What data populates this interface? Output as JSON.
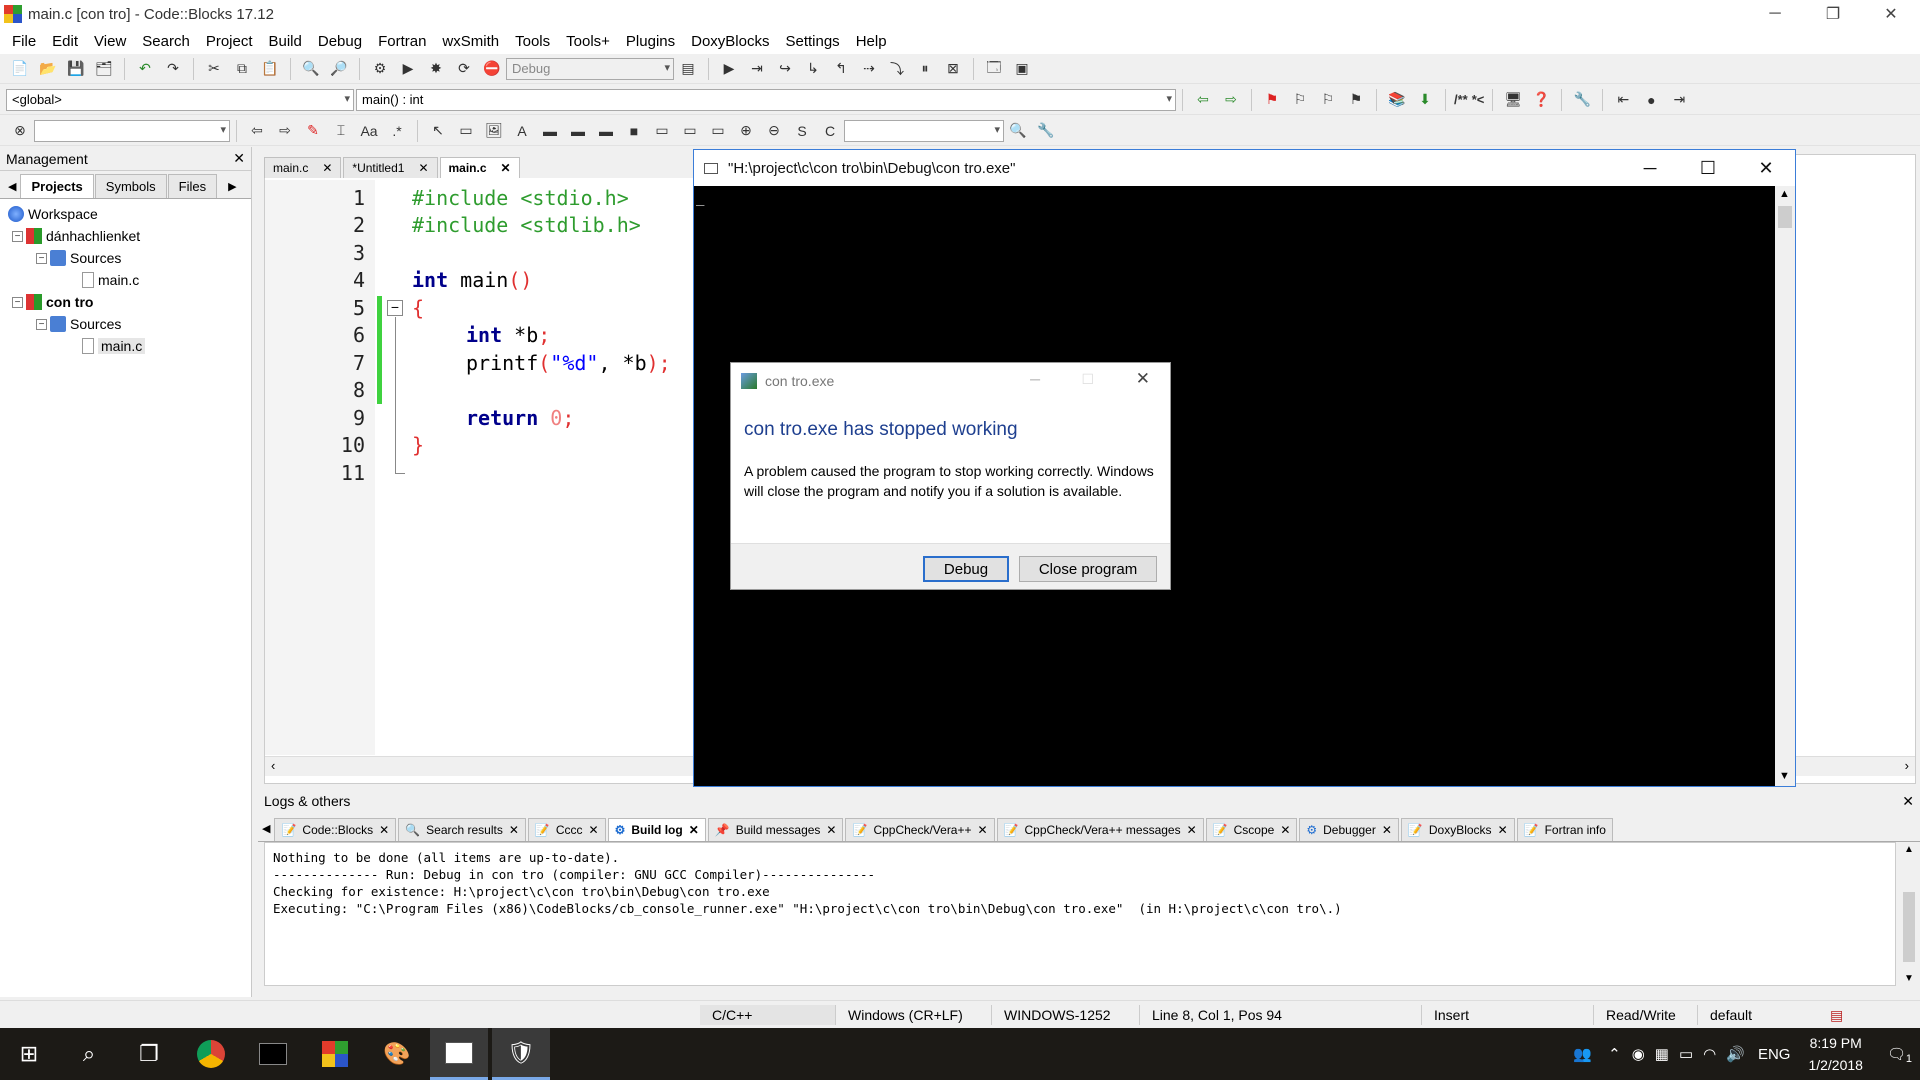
{
  "window": {
    "title": "main.c [con tro] - Code::Blocks 17.12",
    "min": "─",
    "max": "❐",
    "close": "✕"
  },
  "menu": [
    "File",
    "Edit",
    "View",
    "Search",
    "Project",
    "Build",
    "Debug",
    "Fortran",
    "wxSmith",
    "Tools",
    "Tools+",
    "Plugins",
    "DoxyBlocks",
    "Settings",
    "Help"
  ],
  "toolbar": {
    "build_target": "Debug",
    "scope": "<global>",
    "function": "main() : int",
    "doc_comment": "/**",
    "doc_line": "*<"
  },
  "management": {
    "title": "Management",
    "tabs": [
      "Projects",
      "Symbols",
      "Files"
    ],
    "tree": {
      "workspace": "Workspace",
      "projects": [
        {
          "name": "dánhachlienket",
          "folder": "Sources",
          "file": "main.c",
          "bold": false
        },
        {
          "name": "con tro",
          "folder": "Sources",
          "file": "main.c",
          "bold": true
        }
      ]
    }
  },
  "editor": {
    "tabs": [
      "main.c",
      "*Untitled1",
      "main.c"
    ],
    "active_tab": 2,
    "lines": [
      "1",
      "2",
      "3",
      "4",
      "5",
      "6",
      "7",
      "8",
      "9",
      "10",
      "11"
    ],
    "code": {
      "l1": "#include <stdio.h>",
      "l2": "#include <stdlib.h>",
      "l4a": "int",
      "l4b": " main",
      "l4c": "()",
      "l5": "{",
      "l6a": "int",
      "l6b": " *b",
      "l6c": ";",
      "l7a": "printf",
      "l7b": "(",
      "l7c": "\"%d\"",
      "l7d": ", *b",
      "l7e": ");",
      "l9a": "return",
      "l9b": " 0",
      "l9c": ";",
      "l10": "}"
    }
  },
  "console": {
    "title": "\"H:\\project\\c\\con tro\\bin\\Debug\\con tro.exe\"",
    "cursor": "_"
  },
  "dialog": {
    "title": "con tro.exe",
    "heading": "con tro.exe has stopped working",
    "message": "A problem caused the program to stop working correctly. Windows will close the program and notify you if a solution is available.",
    "debug_button": "Debug",
    "close_button": "Close program"
  },
  "logs": {
    "title": "Logs & others",
    "tabs": [
      "Code::Blocks",
      "Search results",
      "Cccc",
      "Build log",
      "Build messages",
      "CppCheck/Vera++",
      "CppCheck/Vera++ messages",
      "Cscope",
      "Debugger",
      "DoxyBlocks",
      "Fortran info"
    ],
    "active_tab": 3,
    "lines": [
      "Nothing to be done (all items are up-to-date).",
      "",
      "",
      "-------------- Run: Debug in con tro (compiler: GNU GCC Compiler)---------------",
      "",
      "Checking for existence: H:\\project\\c\\con tro\\bin\\Debug\\con tro.exe",
      "Executing: \"C:\\Program Files (x86)\\CodeBlocks/cb_console_runner.exe\" \"H:\\project\\c\\con tro\\bin\\Debug\\con tro.exe\"  (in H:\\project\\c\\con tro\\.)"
    ]
  },
  "status": {
    "language": "C/C++",
    "eol": "Windows (CR+LF)",
    "encoding": "WINDOWS-1252",
    "position": "Line 8, Col 1, Pos 94",
    "mode": "Insert",
    "access": "Read/Write",
    "profile": "default"
  },
  "taskbar": {
    "time": "8:19 PM",
    "date": "1/2/2018",
    "lang": "ENG",
    "notifications": "1"
  },
  "colors": {
    "keyword": "#00008b",
    "preproc": "#2e9c2e",
    "string": "#0000ff",
    "number": "#f08080",
    "bracket": "#e03030",
    "dialog_heading": "#1e3f8f"
  }
}
